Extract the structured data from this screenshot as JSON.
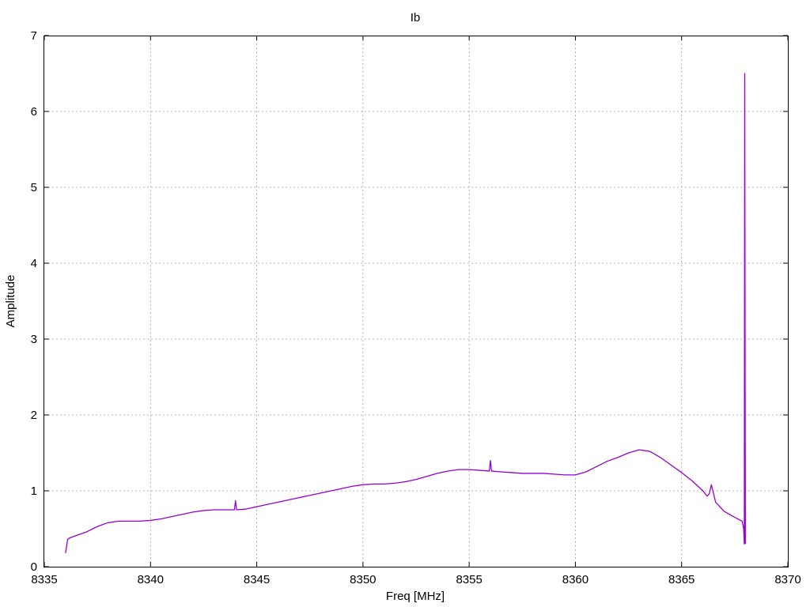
{
  "chart_data": {
    "type": "line",
    "title": "Ib",
    "xlabel": "Freq [MHz]",
    "ylabel": "Amplitude",
    "xlim": [
      8335,
      8370
    ],
    "ylim": [
      0,
      7
    ],
    "xticks": [
      8335,
      8340,
      8345,
      8350,
      8355,
      8360,
      8365,
      8370
    ],
    "yticks": [
      0,
      1,
      2,
      3,
      4,
      5,
      6,
      7
    ],
    "grid": true,
    "legend": "none",
    "series": [
      {
        "color": "#9400d3",
        "x": [
          8336.0,
          8336.1,
          8336.2,
          8336.5,
          8337.0,
          8337.5,
          8338.0,
          8338.5,
          8339.0,
          8339.5,
          8340.0,
          8340.5,
          8341.0,
          8341.5,
          8342.0,
          8342.5,
          8343.0,
          8343.5,
          8343.95,
          8344.0,
          8344.05,
          8344.5,
          8345.0,
          8345.5,
          8346.0,
          8346.5,
          8347.0,
          8347.5,
          8348.0,
          8348.5,
          8349.0,
          8349.5,
          8350.0,
          8350.5,
          8351.0,
          8351.5,
          8352.0,
          8352.5,
          8353.0,
          8353.5,
          8354.0,
          8354.5,
          8355.0,
          8355.5,
          8355.95,
          8356.0,
          8356.05,
          8356.5,
          8357.0,
          8357.5,
          8358.0,
          8358.5,
          8359.0,
          8359.5,
          8360.0,
          8360.5,
          8361.0,
          8361.5,
          8362.0,
          8362.5,
          8363.0,
          8363.5,
          8364.0,
          8364.5,
          8365.0,
          8365.5,
          8366.0,
          8366.2,
          8366.3,
          8366.4,
          8366.6,
          8367.0,
          8367.5,
          8367.85,
          8367.92,
          8367.95,
          8367.97,
          8368.0
        ],
        "values": [
          0.18,
          0.36,
          0.38,
          0.41,
          0.46,
          0.53,
          0.58,
          0.6,
          0.6,
          0.6,
          0.61,
          0.63,
          0.66,
          0.69,
          0.72,
          0.74,
          0.75,
          0.75,
          0.75,
          0.87,
          0.75,
          0.76,
          0.79,
          0.82,
          0.85,
          0.88,
          0.91,
          0.94,
          0.97,
          1.0,
          1.03,
          1.06,
          1.08,
          1.09,
          1.09,
          1.1,
          1.12,
          1.15,
          1.19,
          1.23,
          1.26,
          1.28,
          1.28,
          1.27,
          1.26,
          1.4,
          1.26,
          1.25,
          1.24,
          1.23,
          1.23,
          1.23,
          1.22,
          1.21,
          1.21,
          1.25,
          1.32,
          1.39,
          1.44,
          1.5,
          1.54,
          1.52,
          1.44,
          1.34,
          1.24,
          1.13,
          1.0,
          0.93,
          0.96,
          1.08,
          0.85,
          0.73,
          0.65,
          0.6,
          0.5,
          0.3,
          6.5,
          0.3
        ]
      }
    ]
  }
}
